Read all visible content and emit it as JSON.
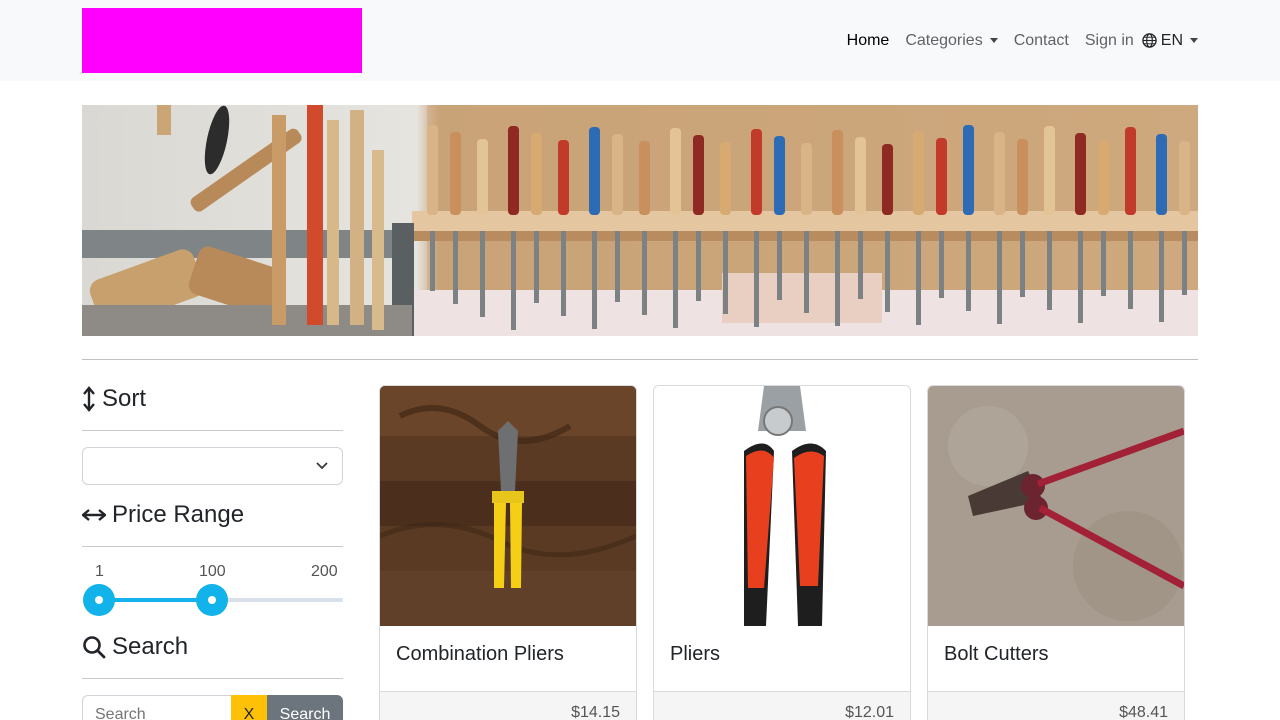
{
  "nav": {
    "home": "Home",
    "categories": "Categories",
    "contact": "Contact",
    "signin": "Sign in",
    "language": "EN"
  },
  "sidebar": {
    "sort_title": "Sort",
    "sort_value": "",
    "price_title": "Price Range",
    "price_min": "1",
    "price_current": "100",
    "price_max": "200",
    "search_title": "Search",
    "search_placeholder": "Search",
    "clear_label": "X",
    "search_button": "Search"
  },
  "products": [
    {
      "name": "Combination Pliers",
      "price": "$14.15"
    },
    {
      "name": "Pliers",
      "price": "$12.01"
    },
    {
      "name": "Bolt Cutters",
      "price": "$48.41"
    }
  ],
  "colors": {
    "logo": "#ff00ff",
    "accent": "#12b2ea",
    "clear_button": "#ffc107",
    "search_button": "#6c757d"
  }
}
